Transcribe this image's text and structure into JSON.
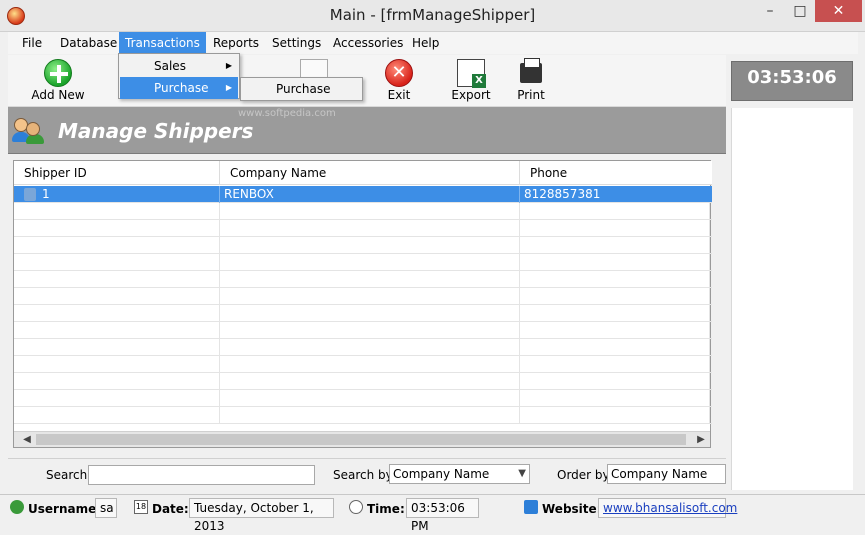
{
  "window": {
    "title": "Main - [frmManageShipper]",
    "min": "–",
    "max": "□",
    "close": "✕"
  },
  "menu": {
    "file": "File",
    "database": "Database",
    "transactions": "Transactions",
    "reports": "Reports",
    "settings": "Settings",
    "accessories": "Accessories",
    "help": "Help"
  },
  "dropdown": {
    "sales": "Sales",
    "purchase": "Purchase",
    "submenu_purchase": "Purchase"
  },
  "toolbar": {
    "add_new": "Add New",
    "exit": "Exit",
    "export": "Export",
    "print": "Print"
  },
  "clock": "03:53:06",
  "watermark": "www.softpedia.com",
  "header": {
    "title": "Manage Shippers"
  },
  "grid": {
    "columns": [
      "Shipper ID",
      "Company Name",
      "Phone"
    ],
    "rows": [
      {
        "id": "1",
        "company": "RENBOX",
        "phone": "8128857381"
      }
    ]
  },
  "search": {
    "search_label": "Search:",
    "search_value": "",
    "search_by_label": "Search by:",
    "search_by_value": "Company Name",
    "order_by_label": "Order by:",
    "order_by_value": "Company Name"
  },
  "status": {
    "username_label": "Username:",
    "username_value": "sa",
    "date_label": "Date:",
    "date_value": "Tuesday, October 1, 2013",
    "time_label": "Time:",
    "time_value": "03:53:06 PM",
    "website_label": "Website:",
    "website_value": "www.bhansalisoft.com",
    "cal_icon_text": "18"
  },
  "colors": {
    "selection": "#3d8ee6",
    "header_band": "#9b9b9b",
    "clock_bg": "#8a8a8a"
  }
}
